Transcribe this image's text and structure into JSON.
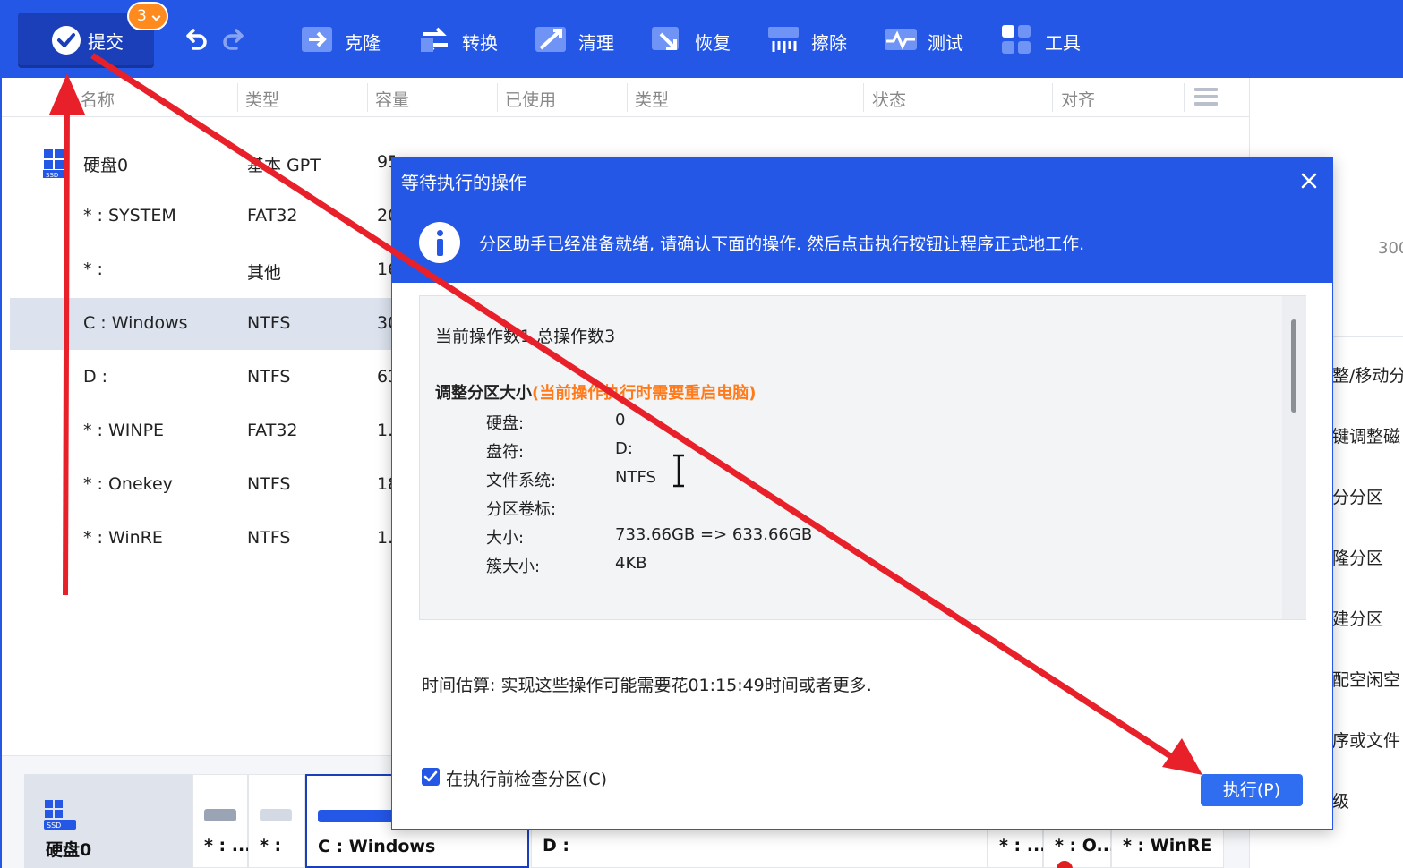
{
  "toolbar": {
    "submit_label": "提交",
    "badge_count": "3",
    "tools": [
      {
        "label": "克隆",
        "icon": "clone-icon"
      },
      {
        "label": "转换",
        "icon": "convert-icon"
      },
      {
        "label": "清理",
        "icon": "cleanup-icon"
      },
      {
        "label": "恢复",
        "icon": "recover-icon"
      },
      {
        "label": "擦除",
        "icon": "wipe-icon"
      },
      {
        "label": "测试",
        "icon": "test-icon"
      },
      {
        "label": "工具",
        "icon": "tools-icon"
      }
    ]
  },
  "table": {
    "headers": [
      "名称",
      "类型",
      "容量",
      "已使用",
      "类型",
      "状态",
      "对齐"
    ],
    "rows": [
      {
        "name": "硬盘0",
        "type": "基本 GPT",
        "capacity": "95"
      },
      {
        "name": "* : SYSTEM",
        "type": "FAT32",
        "capacity": "20"
      },
      {
        "name": "* :",
        "type": "其他",
        "capacity": "16"
      },
      {
        "name": "C : Windows",
        "type": "NTFS",
        "capacity": "30"
      },
      {
        "name": "D :",
        "type": "NTFS",
        "capacity": "63"
      },
      {
        "name": "* : WINPE",
        "type": "FAT32",
        "capacity": "1."
      },
      {
        "name": "* : Onekey",
        "type": "NTFS",
        "capacity": "18"
      },
      {
        "name": "* : WinRE",
        "type": "NTFS",
        "capacity": "1."
      }
    ]
  },
  "right_panel": {
    "number": "300",
    "items": [
      "整/移动分",
      "键调整磁",
      "分分区",
      "隆分区",
      "建分区",
      "配空闲空",
      "序或文件",
      "级"
    ]
  },
  "disk_map": {
    "disk_name": "硬盘0",
    "ssd_label": "SSD",
    "partitions": [
      {
        "label": "* : ...",
        "color": "#9aa4b4"
      },
      {
        "label": "* :",
        "color": "#d4dae3"
      },
      {
        "label": "C : Windows",
        "color": "#2457e6"
      },
      {
        "label": "D :",
        "color": "#2457e6"
      },
      {
        "label": "* : ...",
        "color": "#d4dae3"
      },
      {
        "label": "* : O...",
        "color": "#d4dae3"
      },
      {
        "label": "* : WinRE",
        "color": "#d4dae3"
      }
    ]
  },
  "dialog": {
    "title": "等待执行的操作",
    "message": "分区助手已经准备就绪, 请确认下面的操作. 然后点击执行按钮让程序正式地工作.",
    "op_count": "当前操作数1 总操作数3",
    "op_name": "调整分区大小",
    "op_note": "(当前操作执行时需要重启电脑)",
    "details": [
      {
        "key": "硬盘:",
        "value": "0"
      },
      {
        "key": "盘符:",
        "value": "D:"
      },
      {
        "key": "文件系统:",
        "value": "NTFS"
      },
      {
        "key": "分区卷标:",
        "value": ""
      },
      {
        "key": "大小:",
        "value": "733.66GB => 633.66GB"
      },
      {
        "key": "簇大小:",
        "value": "4KB"
      }
    ],
    "time_estimate": "时间估算: 实现这些操作可能需要花01:15:49时间或者更多.",
    "check_label": "在执行前检查分区(C)",
    "check_checked": true,
    "execute_label": "执行(P)"
  },
  "colors": {
    "brand": "#2457e6",
    "badge": "#ff8a1e",
    "warning": "#ff7a1a",
    "arrow": "#e8202a"
  }
}
